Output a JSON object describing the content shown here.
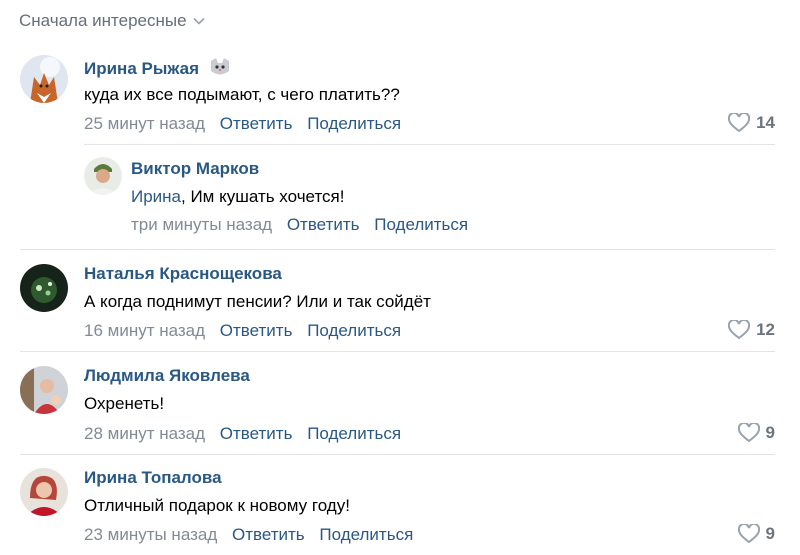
{
  "sort_label": "Сначала интересные",
  "reply_label": "Ответить",
  "share_label": "Поделиться",
  "comments": [
    {
      "name": "Ирина Рыжая",
      "text": "куда их все подымают, с чего платить??",
      "time": "25 минут назад",
      "likes": "14",
      "reply": {
        "name": "Виктор Марков",
        "reply_to": "Ирина",
        "text": ", Им кушать хочется!",
        "time": "три минуты назад"
      }
    },
    {
      "name": "Наталья Краснощекова",
      "text": "А когда поднимут пенсии? Или и так сойдёт",
      "time": "16 минут назад",
      "likes": "12"
    },
    {
      "name": "Людмила Яковлева",
      "text": "Охренеть!",
      "time": "28 минут назад",
      "likes": "9"
    },
    {
      "name": "Ирина Топалова",
      "text": "Отличный подарок к новому году!",
      "time": "23 минуты назад",
      "likes": "9"
    }
  ]
}
